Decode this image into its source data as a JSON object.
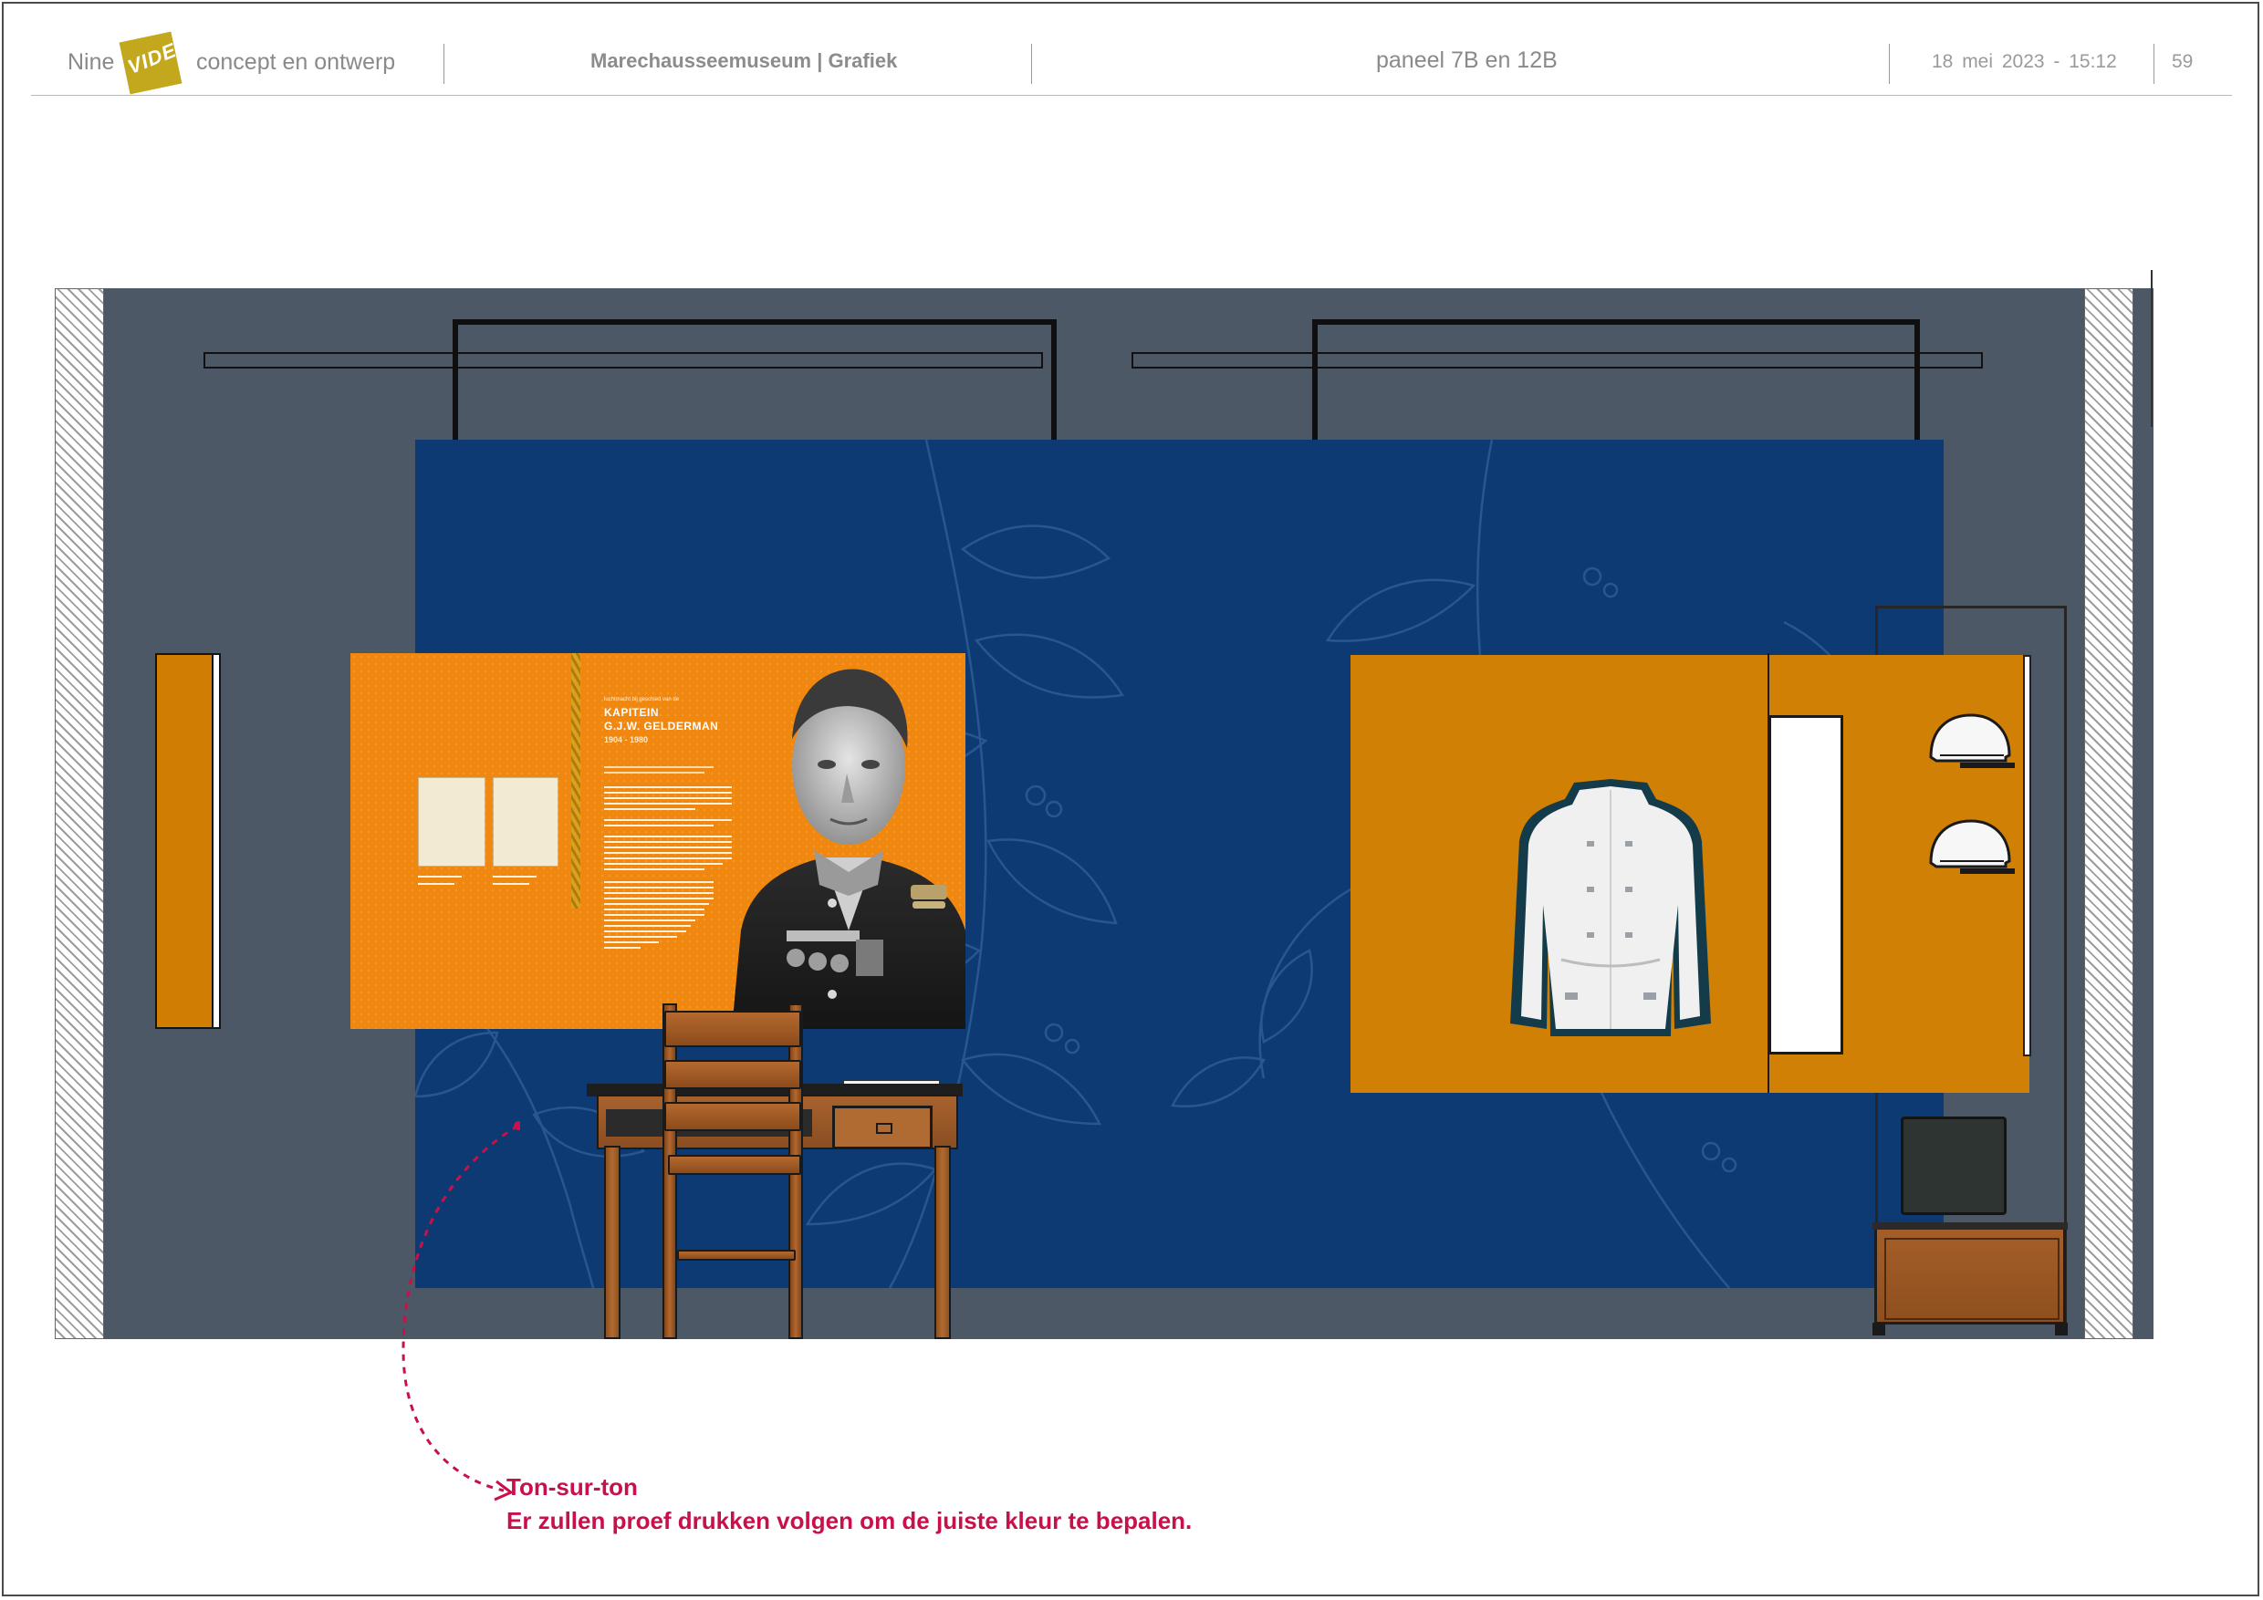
{
  "header": {
    "logo_left": "Nine",
    "logo_badge": "VIDE",
    "logo_right": "concept en ontwerp",
    "client": "Marechausseemuseum | Grafiek",
    "panel": "paneel  7B en 12B",
    "date": "18  mei  2023  -  15:12",
    "page": "59"
  },
  "drawing": {
    "wall_color": "#4d5866",
    "backdrop_color": "#0d3a72",
    "panel_orange": "#f0870f",
    "showcase_orange": "#d08004",
    "info_panel": {
      "eyebrow": "luchtmacht bij geschied van de",
      "title": "KAPITEIN\nG.J.W. GELDERMAN",
      "years": "1904 - 1980"
    }
  },
  "annotation": {
    "color": "#c8104a",
    "line1": "Ton-sur-ton",
    "line2": "Er zullen proef drukken volgen om de juiste kleur te bepalen."
  }
}
